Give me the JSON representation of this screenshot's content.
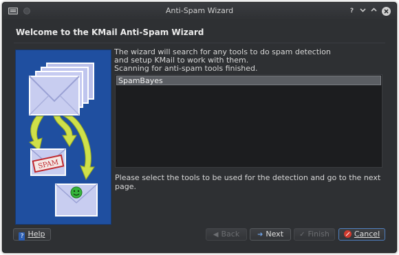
{
  "window": {
    "title": "Anti-Spam Wizard",
    "controls": {
      "help": "?",
      "minimize": "⌄",
      "maximize": "⌃",
      "close": "×"
    }
  },
  "heading": "Welcome to the KMail Anti-Spam Wizard",
  "illustration": {
    "spam_stamp": "SPAM"
  },
  "description": {
    "line1": "The wizard will search for any tools to do spam detection",
    "line2": "and setup KMail to work with them.",
    "line3": "Scanning for anti-spam tools finished."
  },
  "tools_list": [
    "SpamBayes"
  ],
  "hint": "Please select the tools to be used for the detection and go to the next page.",
  "buttons": {
    "help": "Help",
    "back": "Back",
    "next": "Next",
    "finish": "Finish",
    "cancel": "Cancel"
  },
  "colors": {
    "window_bg": "#2e3033",
    "art_bg": "#1f4fa0",
    "envelope": "#c8cdf0",
    "arrow": "#cfe04a",
    "stamp": "#c0282d",
    "smiley": "#35b43a"
  }
}
